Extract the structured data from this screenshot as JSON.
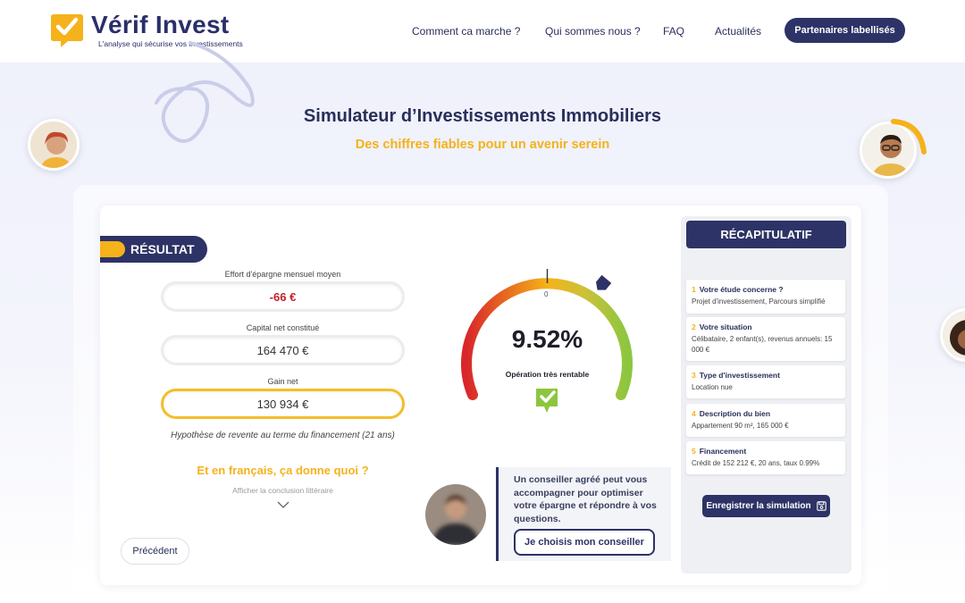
{
  "header": {
    "brand": "Vérif Invest",
    "tagline": "L'analyse qui sécurise vos investissements",
    "nav": [
      {
        "label": "Comment ca marche ?"
      },
      {
        "label": "Qui sommes nous ?"
      },
      {
        "label": "FAQ"
      },
      {
        "label": "Actualités"
      }
    ],
    "cta": "Partenaires labellisés"
  },
  "hero": {
    "title": "Simulateur d’Investissements Immobiliers",
    "subtitle": "Des chiffres fiables pour un avenir serein"
  },
  "result": {
    "tab_label": "RÉSULTAT",
    "fields": [
      {
        "label": "Effort d'épargne mensuel moyen",
        "value": "-66 €"
      },
      {
        "label": "Capital net constitué",
        "value": "164 470 €"
      },
      {
        "label": "Gain net",
        "value": "130 934 €"
      }
    ],
    "hypothesis": "Hypothèse de revente au terme du financement (21 ans)",
    "french_title": "Et en français, ça donne quoi ?",
    "french_link": "Afficher la conclusion littéraire",
    "previous_button": "Précédent"
  },
  "gauge": {
    "zero_label": "0",
    "value": "9.52%",
    "level": 0.9,
    "status": "Opération très rentable",
    "colors": {
      "low": "#d9262b",
      "mid": "#f5b21a",
      "high": "#8cc63f"
    }
  },
  "advisor": {
    "text": "Un conseiller agréé peut vous accompagner pour optimiser votre épargne et répondre à vos questions.",
    "button": "Je choisis mon conseiller"
  },
  "recap": {
    "title": "RÉCAPITULATIF",
    "items": [
      {
        "num": "1",
        "title": "Votre étude concerne ?",
        "detail": "Projet d'investissement, Parcours simplifié"
      },
      {
        "num": "2",
        "title": "Votre situation",
        "detail": "Célibataire, 2 enfant(s), revenus annuels: 15 000 €"
      },
      {
        "num": "3",
        "title": "Type d'investissement",
        "detail": "Location nue"
      },
      {
        "num": "4",
        "title": "Description du bien",
        "detail": "Appartement 90 m², 165 000 €"
      },
      {
        "num": "5",
        "title": "Financement",
        "detail": "Crédit de 152 212 €, 20 ans, taux 0.99%"
      }
    ],
    "save_button": "Enregistrer la simulation"
  },
  "colors": {
    "navy": "#2d3366",
    "gold": "#f5b21a",
    "negative": "#c4212c"
  }
}
